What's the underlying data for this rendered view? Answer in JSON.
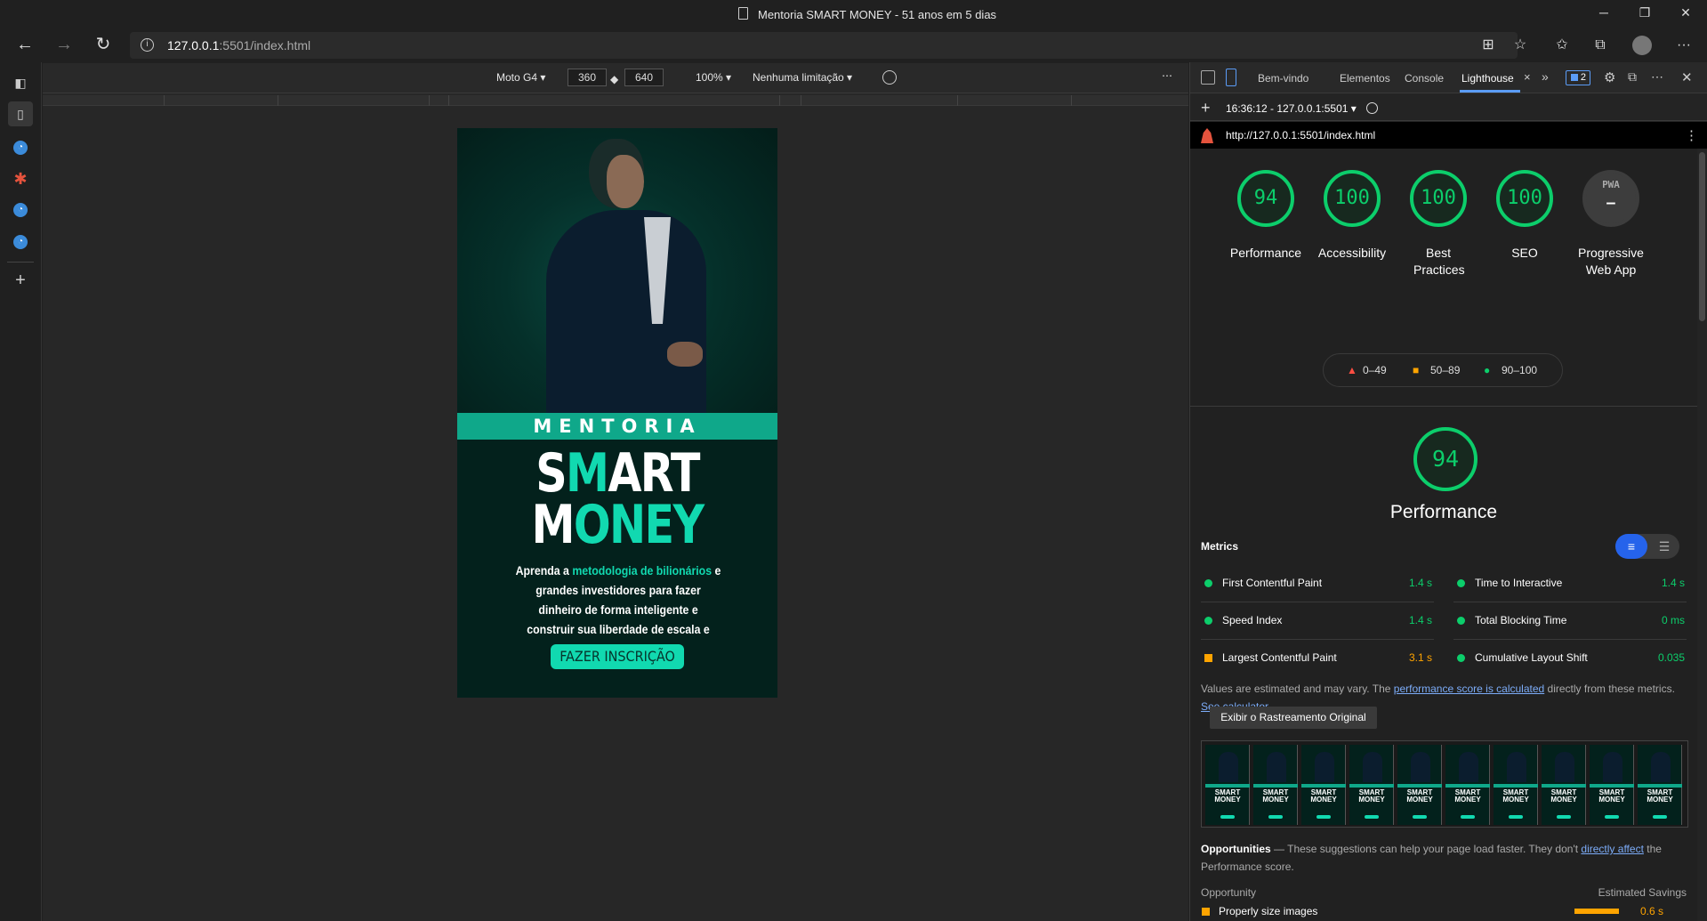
{
  "window": {
    "title": "Mentoria SMART MONEY - 51 anos em 5 dias",
    "minimize": "─",
    "maximize": "❐",
    "close": "✕"
  },
  "nav": {
    "back": "←",
    "forward": "→",
    "reload": "↻",
    "url_host": "127.0.0.1",
    "url_path": ":5501/index.html",
    "more": "···"
  },
  "emulation": {
    "device": "Moto G4 ▾",
    "width": "360",
    "height": "640",
    "zoom": "100% ▾",
    "throttling": "Nenhuma limitação ▾",
    "more": "⋯"
  },
  "page": {
    "band_text": "MENTORIA",
    "smart_pre": "S",
    "smart_hl": "M",
    "smart_post": "ART",
    "money_pre": "M",
    "money_hl": "ONEY",
    "desc_1": "Aprenda a ",
    "desc_hl": "metodologia de bilionários",
    "desc_2": " e grandes investidores para fazer dinheiro de forma inteligente e construir sua liberdade de escala e financeira.",
    "cta": "FAZER INSCRIÇÃO"
  },
  "devtools": {
    "tabs": [
      "Bem-vindo",
      "Elementos",
      "Console",
      "Lighthouse"
    ],
    "tab_close": "×",
    "more_tabs": "»",
    "issues_count": "2",
    "close": "✕",
    "add": "+",
    "report_select": "16:36:12 - 127.0.0.1:5501 ▾",
    "report_url": "http://127.0.0.1:5501/index.html",
    "report_menu": "⋮"
  },
  "lighthouse": {
    "scores": [
      {
        "value": "94",
        "label": "Performance"
      },
      {
        "value": "100",
        "label": "Accessibility"
      },
      {
        "value": "100",
        "label": "Best Practices"
      },
      {
        "value": "100",
        "label": "SEO"
      }
    ],
    "pwa": {
      "badge": "PWA",
      "dash": "—",
      "label": "Progressive Web App"
    },
    "legend": [
      {
        "icon": "▲",
        "range": "0–49",
        "color": "#ff4e42"
      },
      {
        "icon": "■",
        "range": "50–89",
        "color": "#ffa400"
      },
      {
        "icon": "●",
        "range": "90–100",
        "color": "#0cce6b"
      }
    ],
    "perf_score": "94",
    "perf_title": "Performance",
    "metrics_heading": "Metrics",
    "metrics": [
      {
        "name": "First Contentful Paint",
        "value": "1.4 s",
        "status": "good"
      },
      {
        "name": "Time to Interactive",
        "value": "1.4 s",
        "status": "good"
      },
      {
        "name": "Speed Index",
        "value": "1.4 s",
        "status": "good"
      },
      {
        "name": "Total Blocking Time",
        "value": "0 ms",
        "status": "good"
      },
      {
        "name": "Largest Contentful Paint",
        "value": "3.1 s",
        "status": "average"
      },
      {
        "name": "Cumulative Layout Shift",
        "value": "0.035",
        "status": "good"
      }
    ],
    "note_1": "Values are estimated and may vary. The ",
    "note_link1": "performance score is calculated",
    "note_2": " directly from these metrics. ",
    "note_link2": "See calculator.",
    "original_button": "Exibir o Rastreamento Original",
    "film_label": "SMART MONEY",
    "opportunities_title": "Opportunities",
    "opportunities_text": " — These suggestions can help your page load faster. They don't ",
    "opportunities_link": "directly affect",
    "opportunities_text2": " the Performance score.",
    "opp_col1": "Opportunity",
    "opp_col2": "Estimated Savings",
    "opp_first": "Properly size images",
    "opp_first_value": "0.6 s"
  }
}
